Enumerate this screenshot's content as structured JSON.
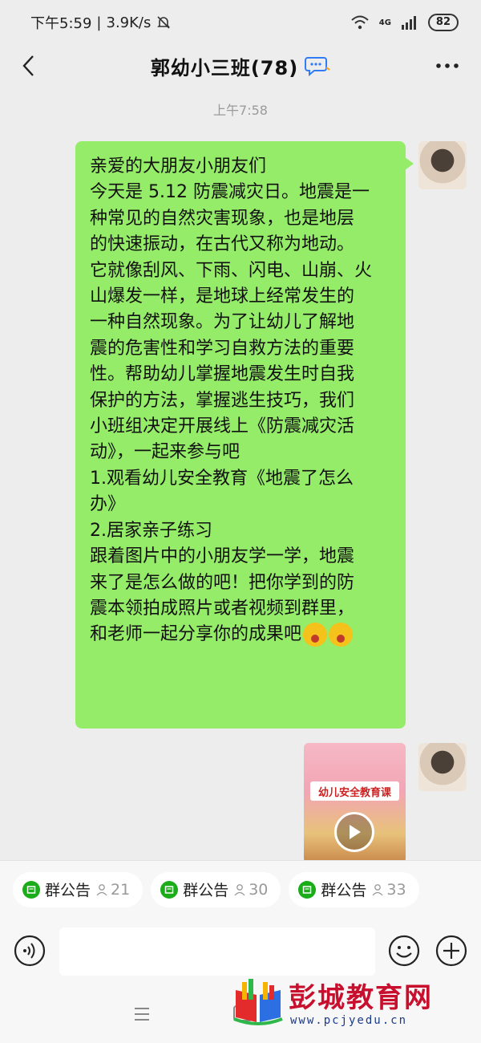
{
  "status_bar": {
    "time": "下午5:59",
    "speed": "3.9K/s",
    "network": "4G",
    "battery": "82"
  },
  "header": {
    "title": "郭幼小三班(78)"
  },
  "chat": {
    "timestamp": "上午7:58",
    "message_lines": [
      "亲爱的大朋友小朋友们",
      "今天是 5.12 防震减灾日。地震是一",
      "种常见的自然灾害现象，也是地层",
      "的快速振动，在古代又称为地动。",
      "它就像刮风、下雨、闪电、山崩、火",
      "山爆发一样，是地球上经常发生的",
      "一种自然现象。为了让幼儿了解地",
      "震的危害性和学习自救方法的重要",
      "性。帮助幼儿掌握地震发生时自我",
      "保护的方法，掌握逃生技巧，我们",
      "小班组决定开展线上《防震减灾活",
      "动》，一起来参与吧",
      "1.观看幼儿安全教育《地震了怎么",
      "办》",
      "2.居家亲子练习",
      "跟着图片中的小朋友学一学，地震",
      "来了是怎么做的吧！把你学到的防",
      "震本领拍成照片或者视频到群里，",
      "和老师一起分享你的成果吧"
    ],
    "video_card": {
      "label": "幼儿安全教育课"
    }
  },
  "notices": [
    {
      "label": "群公告",
      "count": "21"
    },
    {
      "label": "群公告",
      "count": "30"
    },
    {
      "label": "群公告",
      "count": "33"
    }
  ],
  "input": {
    "placeholder": "",
    "value": ""
  },
  "watermark": {
    "name": "彭城教育网",
    "url": "www.pcjyedu.cn"
  },
  "colors": {
    "bubble": "#95ec69",
    "background": "#ededed",
    "accent": "#1aad19",
    "watermark_red": "#c8102e"
  }
}
